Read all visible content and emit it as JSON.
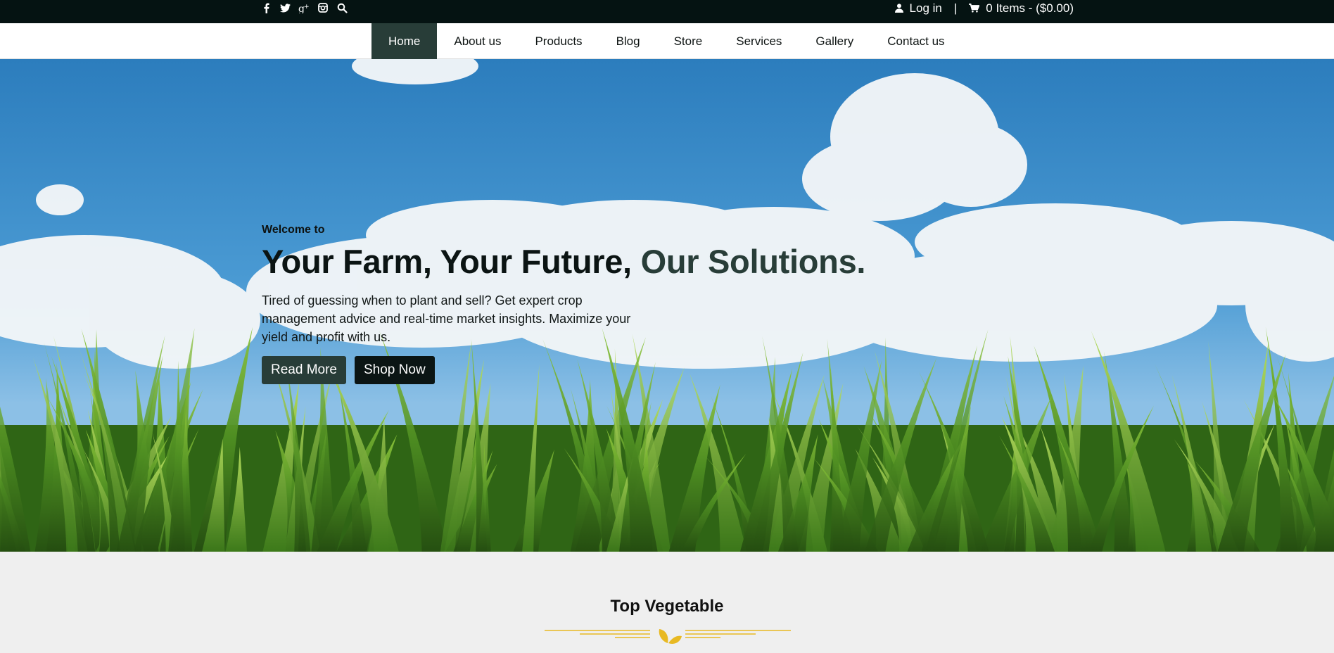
{
  "topbar": {
    "social_icons": [
      "facebook-icon",
      "twitter-icon",
      "google-plus-icon",
      "instagram-icon",
      "search-icon"
    ],
    "login_label": "Log in",
    "separator": "|",
    "cart_label": "0 Items - ($0.00)"
  },
  "nav": {
    "items": [
      {
        "label": "Home",
        "active": true
      },
      {
        "label": "About us"
      },
      {
        "label": "Products"
      },
      {
        "label": "Blog"
      },
      {
        "label": "Store"
      },
      {
        "label": "Services"
      },
      {
        "label": "Gallery"
      },
      {
        "label": "Contact us"
      }
    ]
  },
  "hero": {
    "eyebrow": "Welcome to",
    "headline_main": "Your Farm, Your Future,",
    "headline_accent": "Our Solutions.",
    "lede": "Tired of guessing when to plant and sell? Get expert crop management advice and real-time market insights. Maximize your yield and profit with us.",
    "read_more_label": "Read More",
    "shop_now_label": "Shop Now"
  },
  "section": {
    "title": "Top Vegetable"
  },
  "colors": {
    "topbar_bg": "#051312",
    "accent": "#283d38",
    "divider": "#e8b923"
  }
}
